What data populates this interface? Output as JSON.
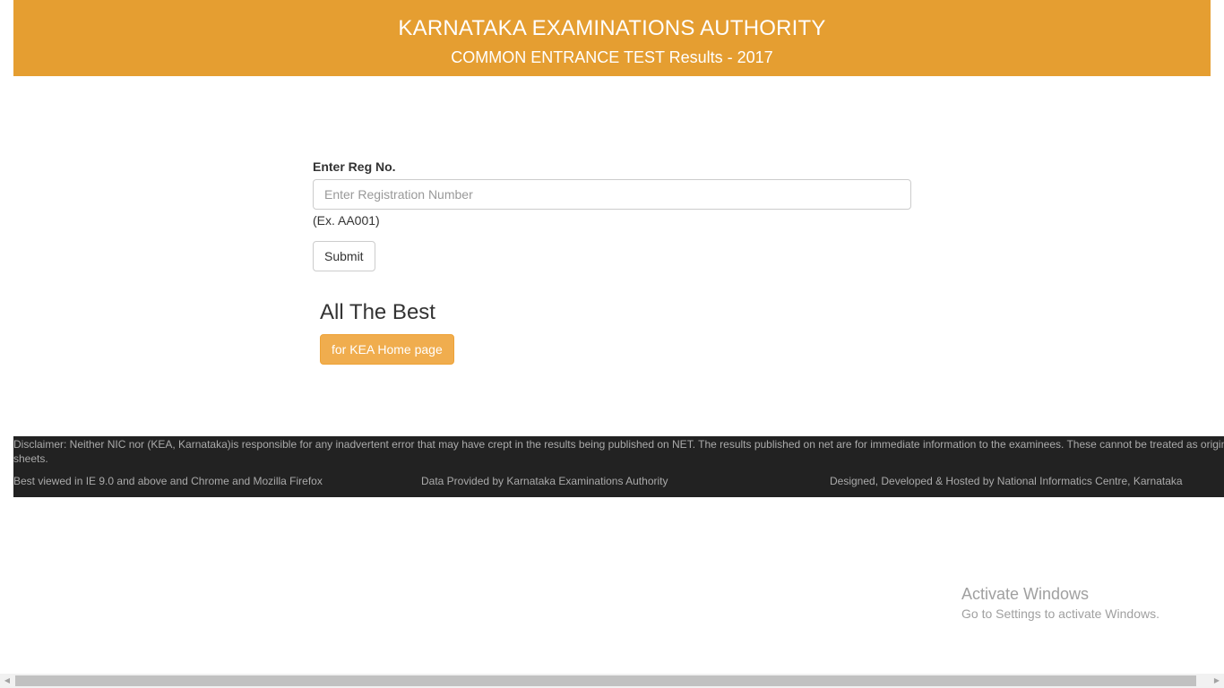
{
  "header": {
    "title": "KARNATAKA EXAMINATIONS AUTHORITY",
    "subtitle": "COMMON ENTRANCE TEST Results - 2017"
  },
  "form": {
    "label": "Enter Reg No.",
    "input_placeholder": "Enter Registration Number",
    "input_value": "",
    "hint": "(Ex. AA001)",
    "submit_label": "Submit"
  },
  "best": {
    "text": "All The Best",
    "home_button_label": "for KEA Home page"
  },
  "footer": {
    "disclaimer_line1": "Disclaimer: Neither NIC  nor (KEA, Karnataka)is responsible for any inadvertent error that may have crept in the results being published on NET. The results published on net are for immediate information to the examinees. These cannot be treated as original mar",
    "disclaimer_line2": "sheets.",
    "browser_note": "Best viewed in IE 9.0 and above and Chrome and Mozilla Firefox",
    "data_provider": "Data Provided by Karnataka Examinations Authority",
    "designer": "Designed, Developed & Hosted by National Informatics Centre, Karnataka"
  },
  "watermark": {
    "title": "Activate Windows",
    "subtitle": "Go to Settings to activate Windows."
  },
  "scrollbar": {
    "left_icon": "triangle-left-icon",
    "right_icon": "triangle-right-icon"
  },
  "colors": {
    "header_bg": "#e59e31",
    "button_warning": "#f0ad4e",
    "footer_bg": "#222222"
  }
}
